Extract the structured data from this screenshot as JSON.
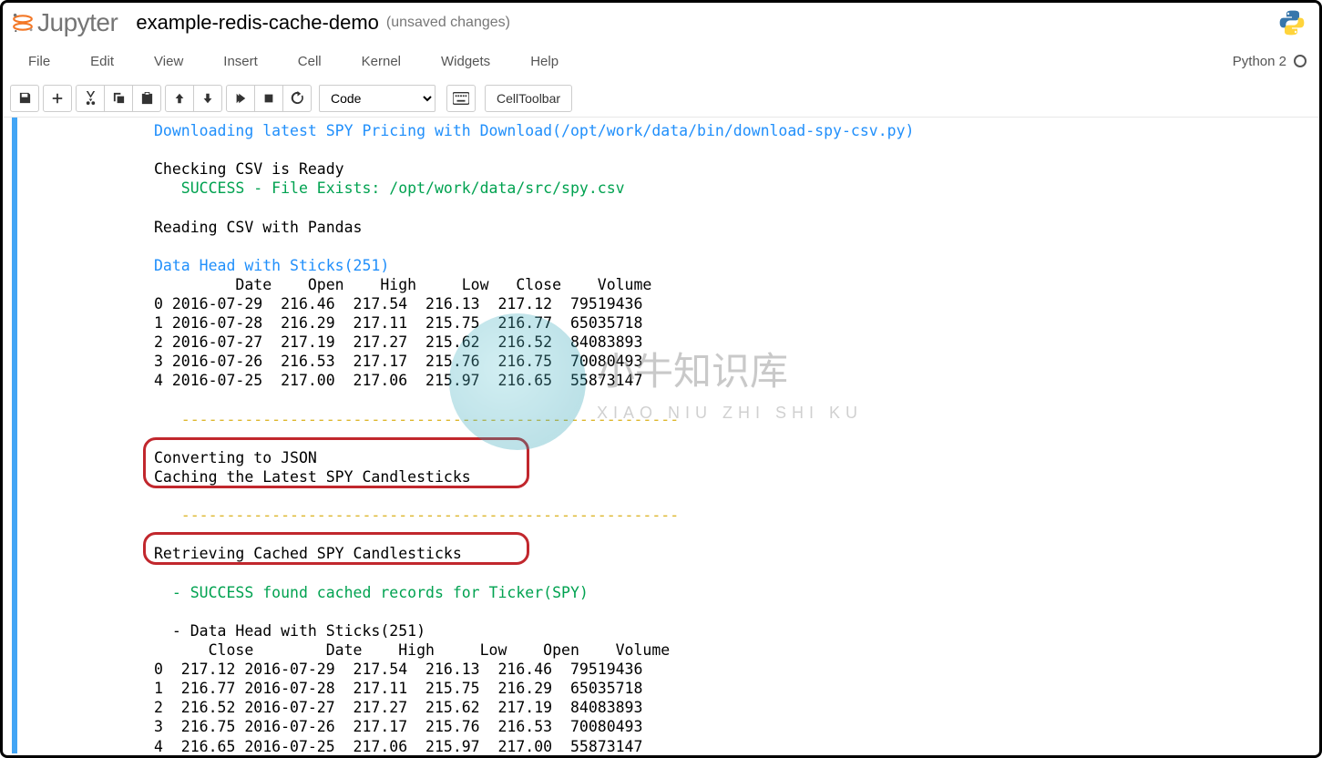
{
  "header": {
    "logo_text": "Jupyter",
    "notebook_name": "example-redis-cache-demo",
    "save_status": "(unsaved changes)"
  },
  "menubar": {
    "items": [
      "File",
      "Edit",
      "View",
      "Insert",
      "Cell",
      "Kernel",
      "Widgets",
      "Help"
    ],
    "kernel_name": "Python 2"
  },
  "toolbar": {
    "cell_type": "Code",
    "cell_toolbar_label": "CellToolbar"
  },
  "output": {
    "line_download": "Downloading latest SPY Pricing with Download(/opt/work/data/bin/download-spy-csv.py)",
    "line_check": "Checking CSV is Ready",
    "line_success_file": "   SUCCESS - File Exists: /opt/work/data/src/spy.csv",
    "line_reading": "Reading CSV with Pandas",
    "line_datahead": "Data Head with Sticks(251)",
    "table1_header": "         Date    Open    High     Low   Close    Volume",
    "table1_rows": [
      "0 2016-07-29  216.46  217.54  216.13  217.12  79519436",
      "1 2016-07-28  216.29  217.11  215.75  216.77  65035718",
      "2 2016-07-27  217.19  217.27  215.62  216.52  84083893",
      "3 2016-07-26  216.53  217.17  215.76  216.75  70080493",
      "4 2016-07-25  217.00  217.06  215.97  216.65  55873147"
    ],
    "dashes": "   -------------------------------------------------------",
    "line_converting": "Converting to JSON",
    "line_caching": "Caching the Latest SPY Candlesticks",
    "line_retrieving": "Retrieving Cached SPY Candlesticks",
    "line_success_cache": "  - SUCCESS found cached records for Ticker(SPY)",
    "line_datahead2": "  - Data Head with Sticks(251)",
    "table2_header": "      Close        Date    High     Low    Open    Volume",
    "table2_rows": [
      "0  217.12 2016-07-29  217.54  216.13  216.46  79519436",
      "1  216.77 2016-07-28  217.11  215.75  216.29  65035718",
      "2  216.52 2016-07-27  217.27  215.62  217.19  84083893",
      "3  216.75 2016-07-26  217.17  215.76  216.53  70080493",
      "4  216.65 2016-07-25  217.06  215.97  217.00  55873147"
    ]
  },
  "watermark": {
    "main": "小牛知识库",
    "sub": "XIAO NIU ZHI SHI KU"
  },
  "chart_data": {
    "type": "table",
    "title": "SPY Candlesticks",
    "tables": [
      {
        "name": "Data Head with Sticks(251)",
        "columns": [
          "Date",
          "Open",
          "High",
          "Low",
          "Close",
          "Volume"
        ],
        "rows": [
          [
            "2016-07-29",
            216.46,
            217.54,
            216.13,
            217.12,
            79519436
          ],
          [
            "2016-07-28",
            216.29,
            217.11,
            215.75,
            216.77,
            65035718
          ],
          [
            "2016-07-27",
            217.19,
            217.27,
            215.62,
            216.52,
            84083893
          ],
          [
            "2016-07-26",
            216.53,
            217.17,
            215.76,
            216.75,
            70080493
          ],
          [
            "2016-07-25",
            217.0,
            217.06,
            215.97,
            216.65,
            55873147
          ]
        ]
      },
      {
        "name": "Cached Data Head with Sticks(251)",
        "columns": [
          "Close",
          "Date",
          "High",
          "Low",
          "Open",
          "Volume"
        ],
        "rows": [
          [
            217.12,
            "2016-07-29",
            217.54,
            216.13,
            216.46,
            79519436
          ],
          [
            216.77,
            "2016-07-28",
            217.11,
            215.75,
            216.29,
            65035718
          ],
          [
            216.52,
            "2016-07-27",
            217.27,
            215.62,
            217.19,
            84083893
          ],
          [
            216.75,
            "2016-07-26",
            217.17,
            215.76,
            216.53,
            70080493
          ],
          [
            216.65,
            "2016-07-25",
            217.06,
            215.97,
            217.0,
            55873147
          ]
        ]
      }
    ]
  }
}
